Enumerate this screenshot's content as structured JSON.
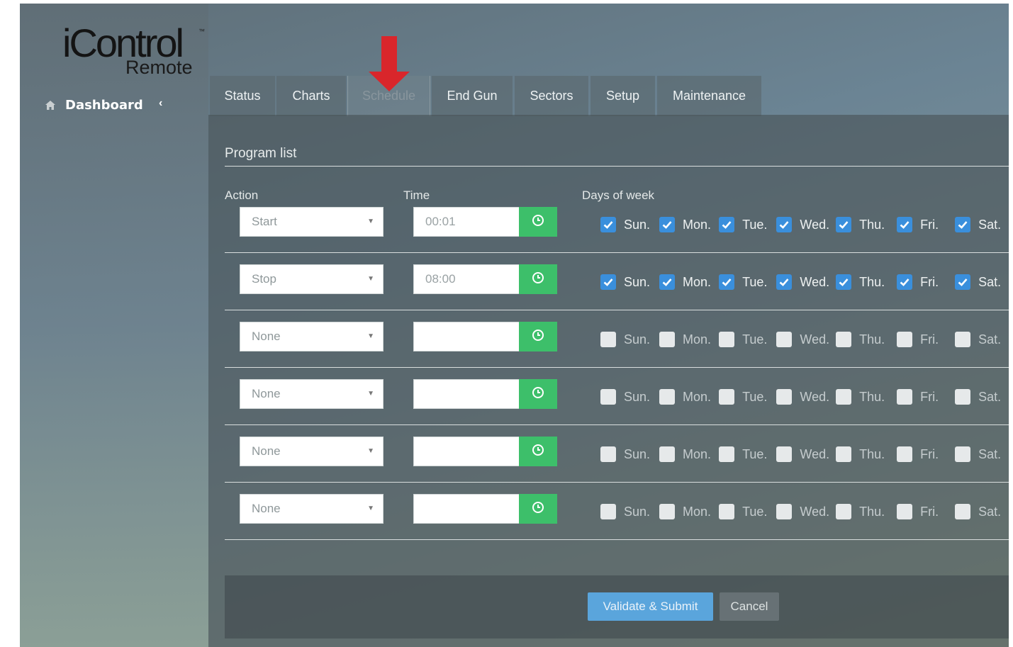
{
  "logo": {
    "brand": "iControl",
    "trademark": "™",
    "sub": "Remote"
  },
  "sidebar": {
    "dashboard_label": "Dashboard",
    "dashboard_icon": "home-icon",
    "collapse_icon": "chevron-left-icon"
  },
  "tabs": [
    {
      "label": "Status",
      "active": false
    },
    {
      "label": "Charts",
      "active": false
    },
    {
      "label": "Schedule",
      "active": true
    },
    {
      "label": "End Gun",
      "active": false
    },
    {
      "label": "Sectors",
      "active": false
    },
    {
      "label": "Setup",
      "active": false
    },
    {
      "label": "Maintenance",
      "active": false
    }
  ],
  "panel": {
    "title": "Program list",
    "columns": {
      "action": "Action",
      "time": "Time",
      "days": "Days of week"
    }
  },
  "day_labels": [
    "Sun.",
    "Mon.",
    "Tue.",
    "Wed.",
    "Thu.",
    "Fri.",
    "Sat."
  ],
  "programs": [
    {
      "action": "Start",
      "time": "00:01",
      "days": [
        true,
        true,
        true,
        true,
        true,
        true,
        true
      ]
    },
    {
      "action": "Stop",
      "time": "08:00",
      "days": [
        true,
        true,
        true,
        true,
        true,
        true,
        true
      ]
    },
    {
      "action": "None",
      "time": "",
      "days": [
        false,
        false,
        false,
        false,
        false,
        false,
        false
      ]
    },
    {
      "action": "None",
      "time": "",
      "days": [
        false,
        false,
        false,
        false,
        false,
        false,
        false
      ]
    },
    {
      "action": "None",
      "time": "",
      "days": [
        false,
        false,
        false,
        false,
        false,
        false,
        false
      ]
    },
    {
      "action": "None",
      "time": "",
      "days": [
        false,
        false,
        false,
        false,
        false,
        false,
        false
      ]
    }
  ],
  "footer": {
    "submit_label": "Validate & Submit",
    "cancel_label": "Cancel"
  },
  "colors": {
    "accent_green": "#3dbf6a",
    "checkbox_blue": "#3a8fdc",
    "submit_blue": "#5aa5dc",
    "arrow_red": "#d9262b"
  },
  "icons": {
    "time_button": "clock-icon",
    "annotation": "down-arrow-icon"
  }
}
